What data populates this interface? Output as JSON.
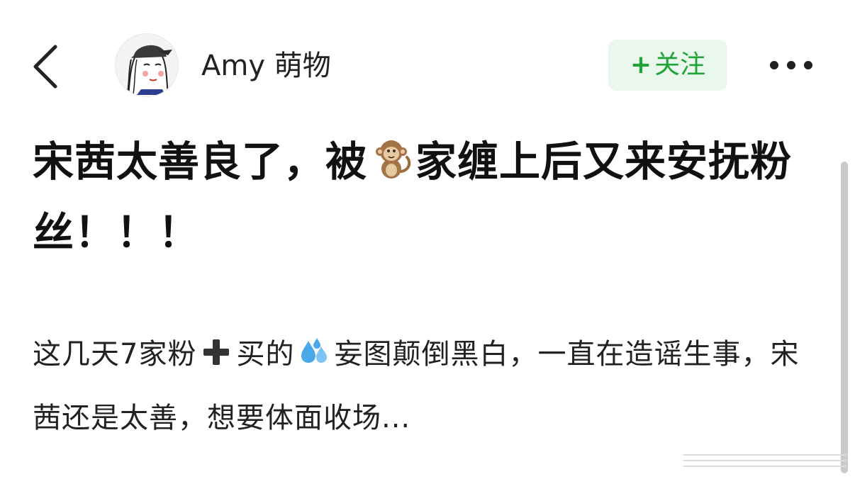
{
  "header": {
    "author_name": "Amy 萌物",
    "follow_label": "关注",
    "follow_plus": "+"
  },
  "post": {
    "title_part1": "宋茜太善良了，被",
    "title_part2": "家缠上后又来安抚粉丝！！！",
    "body_part1": "这几天7家粉",
    "body_part2": "买的",
    "body_part3": "妄图颠倒黑白，一直在造谣生事，宋茜还是太善，想要体面收场..."
  },
  "icons": {
    "back": "chevron-left-icon",
    "more": "more-dots-icon",
    "monkey": "monkey-emoji",
    "plus": "heavy-plus-emoji",
    "sweat": "sweat-droplets-emoji"
  },
  "colors": {
    "follow_text": "#22a33a",
    "follow_bg": "#eaf7ec",
    "title": "#111111",
    "body": "#222222"
  }
}
